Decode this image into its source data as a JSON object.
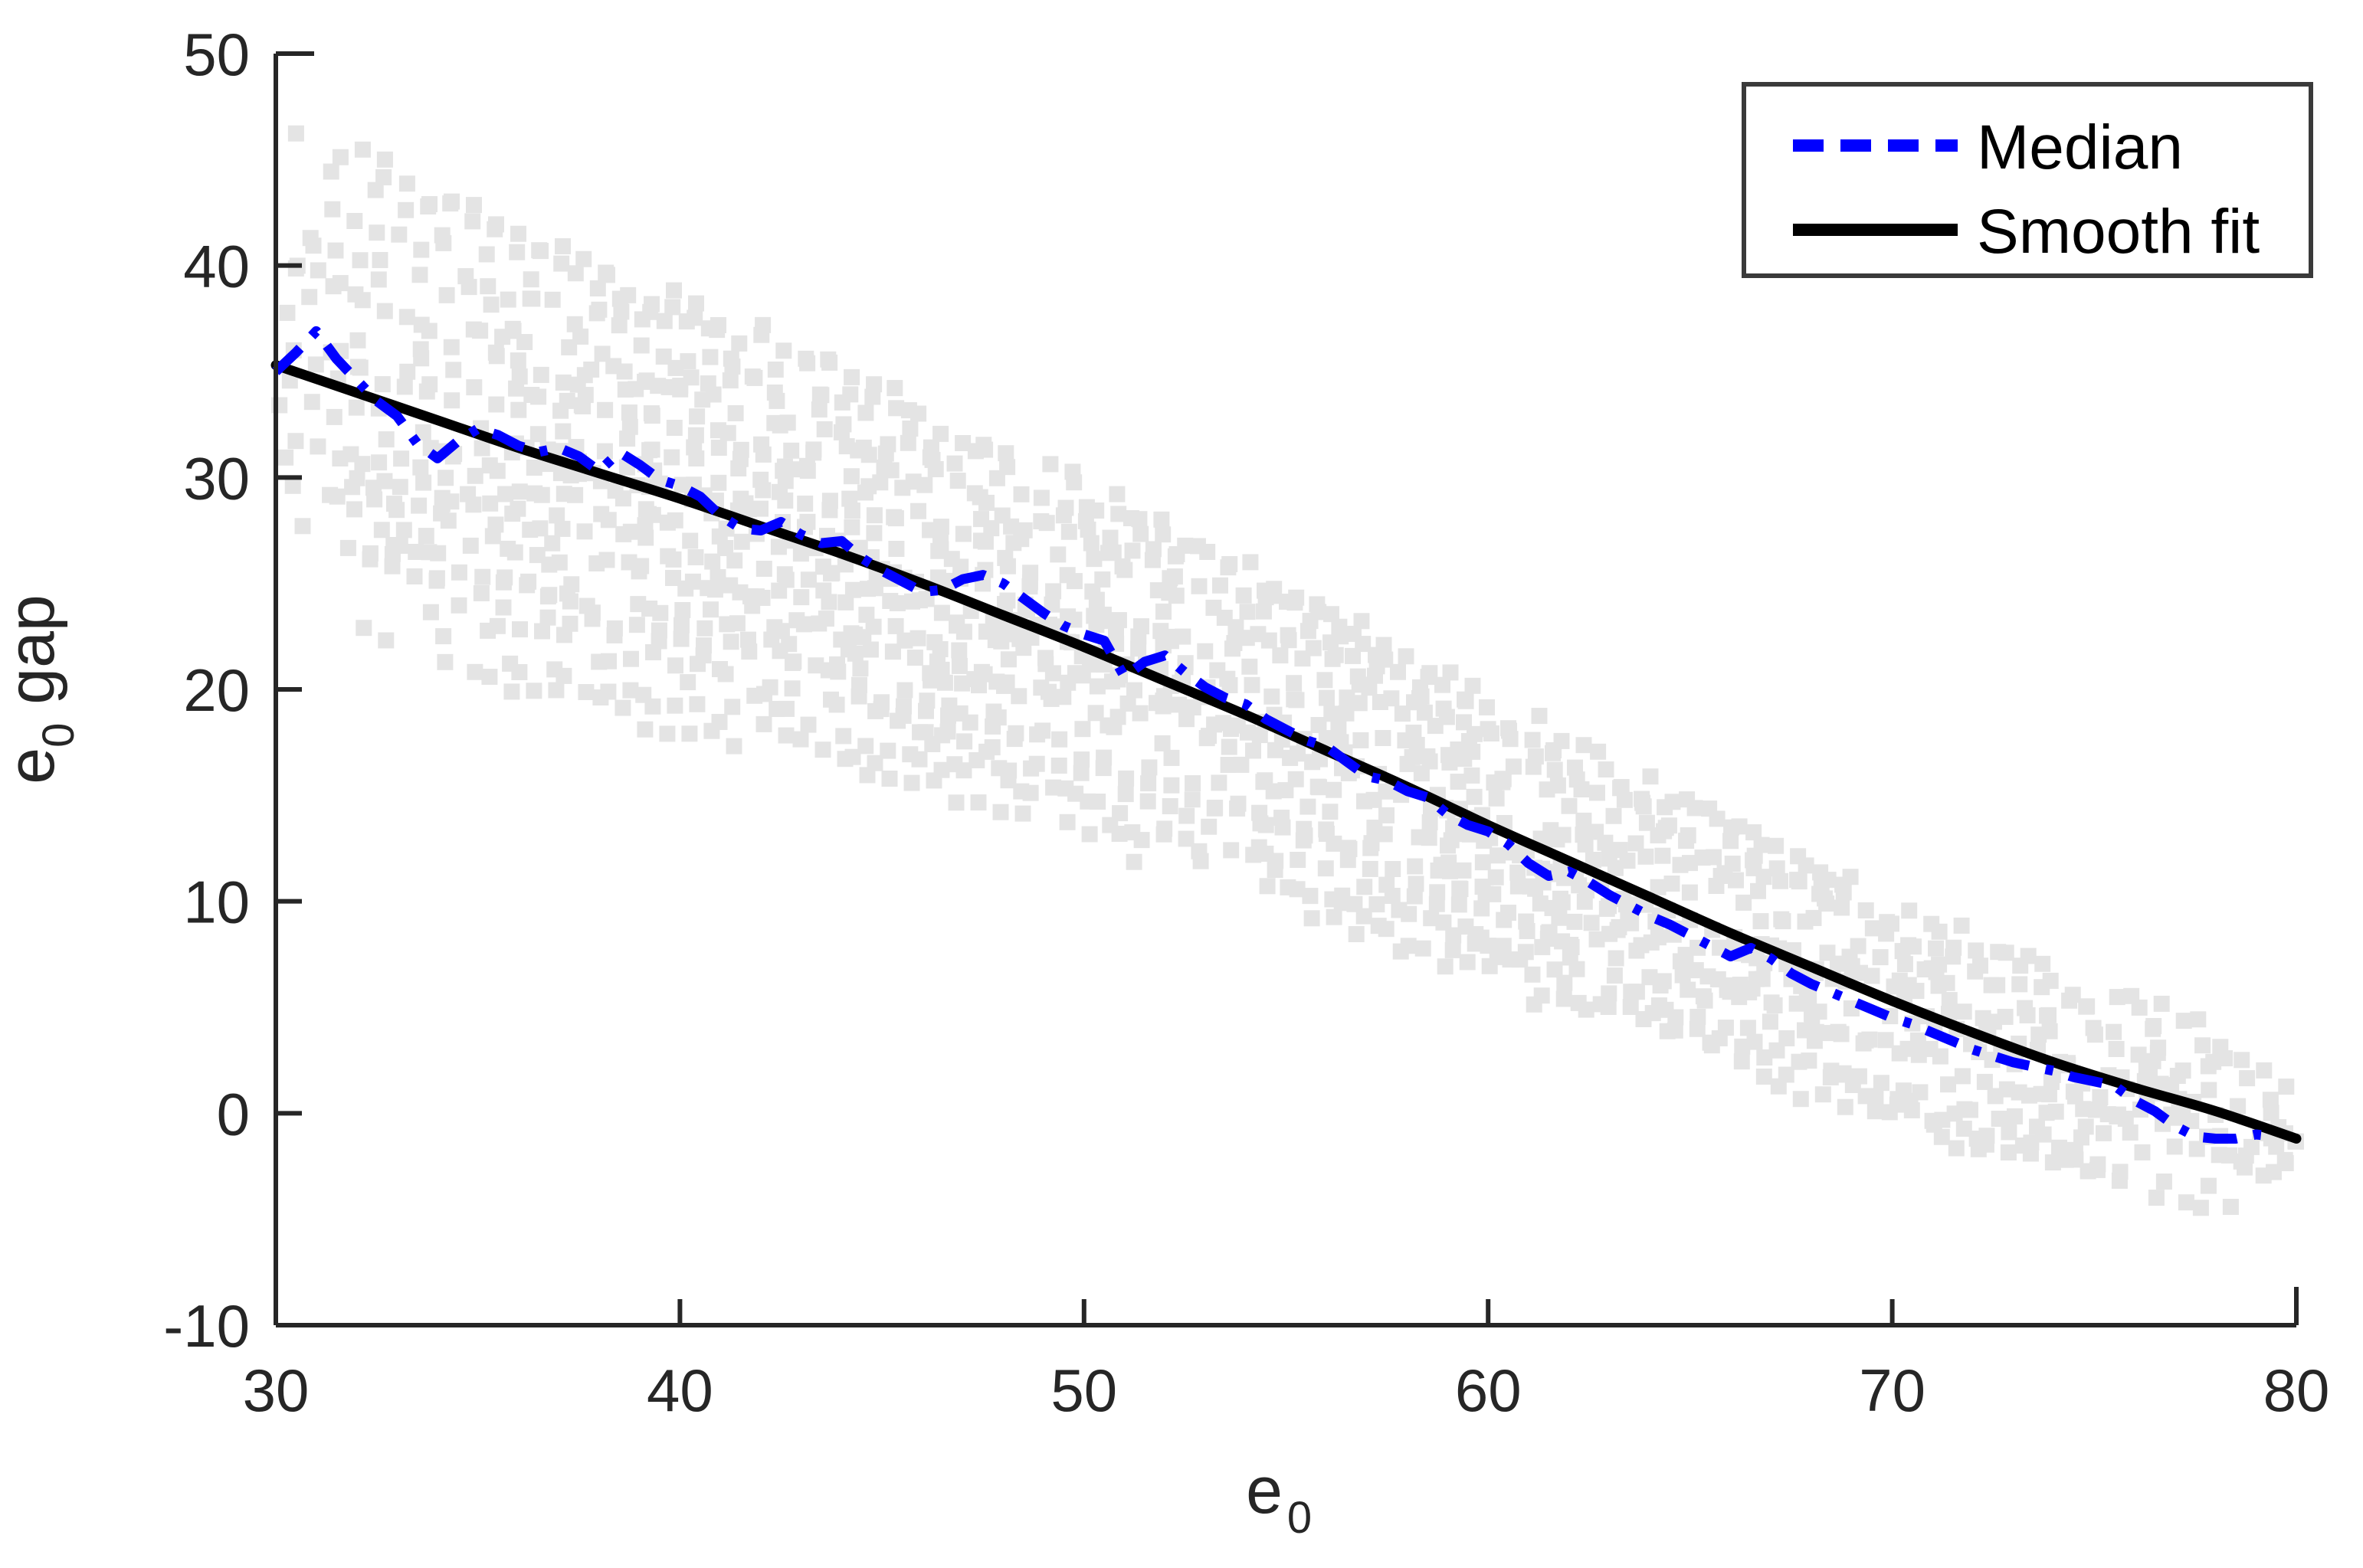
{
  "chart_data": {
    "type": "scatter",
    "title": "",
    "subtitle": "",
    "xlabel": "e",
    "xlabel_sub": "0",
    "ylabel": "e",
    "ylabel_sub": "0",
    "ylabel_rest": " gap",
    "xlim": [
      30,
      80
    ],
    "ylim": [
      -10,
      50
    ],
    "xticks": [
      30,
      40,
      50,
      60,
      70,
      80
    ],
    "xticklabels": [
      "30",
      "40",
      "50",
      "60",
      "70",
      "80"
    ],
    "yticks": [
      -10,
      0,
      10,
      20,
      30,
      40,
      50
    ],
    "yticklabels": [
      "-10",
      "0",
      "10",
      "20",
      "30",
      "40",
      "50"
    ],
    "grid": false,
    "legend_position": "upper-right",
    "colors": {
      "median": "#0000ff",
      "smooth_fit": "#000000",
      "scatter": "#e4e4e4",
      "axis": "#262626"
    },
    "legend": [
      {
        "label": "Median",
        "style": "dashdot",
        "color": "#0000ff"
      },
      {
        "label": "Smooth fit",
        "style": "solid",
        "color": "#000000"
      }
    ],
    "series": [
      {
        "name": "Median",
        "style": "dashdot",
        "color": "#0000ff",
        "x": [
          30.0,
          30.5,
          31.0,
          31.5,
          32.0,
          32.5,
          33.0,
          33.5,
          34.0,
          34.5,
          35.0,
          35.5,
          36.0,
          36.5,
          37.0,
          37.5,
          38.0,
          38.5,
          39.0,
          39.5,
          40.0,
          40.5,
          41.0,
          41.5,
          42.0,
          42.5,
          43.0,
          43.5,
          44.0,
          44.5,
          45.0,
          45.5,
          46.0,
          46.5,
          47.0,
          47.5,
          48.0,
          48.5,
          49.0,
          49.5,
          50.0,
          50.5,
          51.0,
          51.5,
          52.0,
          52.5,
          53.0,
          53.5,
          54.0,
          54.5,
          55.0,
          55.5,
          56.0,
          56.5,
          57.0,
          57.5,
          58.0,
          58.5,
          59.0,
          59.5,
          60.0,
          60.5,
          61.0,
          61.5,
          62.0,
          62.5,
          63.0,
          63.5,
          64.0,
          64.5,
          65.0,
          65.5,
          66.0,
          66.5,
          67.0,
          67.5,
          68.0,
          68.5,
          69.0,
          69.5,
          70.0,
          70.5,
          71.0,
          71.5,
          72.0,
          72.5,
          73.0,
          73.5,
          74.0,
          74.5,
          75.0,
          75.5,
          76.0,
          76.5,
          77.0,
          77.5,
          78.0,
          78.5,
          79.0,
          79.5
        ],
        "y": [
          35.0,
          35.9,
          36.9,
          35.6,
          34.6,
          33.6,
          32.9,
          31.6,
          30.9,
          31.7,
          32.3,
          32.0,
          31.5,
          31.2,
          31.4,
          31.0,
          30.3,
          31.2,
          30.6,
          29.9,
          29.6,
          29.1,
          28.2,
          27.6,
          27.5,
          27.9,
          27.3,
          26.9,
          27.0,
          26.2,
          25.6,
          25.1,
          24.6,
          24.7,
          25.2,
          25.4,
          25.0,
          24.3,
          23.6,
          23.0,
          22.6,
          22.3,
          20.6,
          21.3,
          21.6,
          20.8,
          20.1,
          19.6,
          19.3,
          18.6,
          18.1,
          17.6,
          17.3,
          16.6,
          15.9,
          15.7,
          15.2,
          14.9,
          14.1,
          13.6,
          13.3,
          12.7,
          11.8,
          11.2,
          11.4,
          10.9,
          10.3,
          9.8,
          9.3,
          8.9,
          8.4,
          7.9,
          7.4,
          7.8,
          7.3,
          6.6,
          6.1,
          5.7,
          5.3,
          4.9,
          4.5,
          4.2,
          3.8,
          3.4,
          3.0,
          2.7,
          2.4,
          2.2,
          2.0,
          1.7,
          1.5,
          1.3,
          0.6,
          0.1,
          -0.6,
          -1.1,
          -1.2,
          -1.2,
          -1.0,
          -1.1
        ]
      },
      {
        "name": "Smooth fit",
        "style": "solid",
        "color": "#000000",
        "x": [
          30,
          32,
          34,
          36,
          38,
          40,
          42,
          44,
          46,
          48,
          50,
          52,
          54,
          56,
          58,
          60,
          62,
          64,
          66,
          68,
          70,
          72,
          74,
          76,
          78,
          80
        ],
        "y": [
          35.3,
          34.0,
          32.7,
          31.4,
          30.2,
          29.0,
          27.7,
          26.4,
          25.0,
          23.5,
          22.0,
          20.4,
          18.8,
          17.1,
          15.4,
          13.6,
          11.9,
          10.2,
          8.5,
          6.9,
          5.3,
          3.8,
          2.4,
          1.2,
          0.1,
          -1.2
        ]
      }
    ],
    "scatter": {
      "name": "data points",
      "color": "#e4e4e4",
      "marker": "square",
      "n_visible_approx": 900,
      "description": "Light gray square markers forming diagonal striped bands that fan out below and above the fitted line",
      "y_spread_at_x30": [
        29,
        41
      ],
      "y_spread_at_x55": [
        9,
        24
      ],
      "y_spread_at_x80": [
        -3,
        3
      ]
    }
  },
  "axes": {
    "tick_color": "#262626",
    "line_width": 5
  }
}
